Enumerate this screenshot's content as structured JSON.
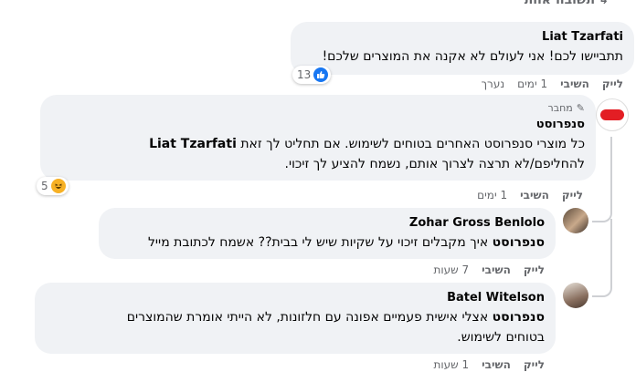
{
  "header": {
    "label": "תשובה אחת"
  },
  "comments": [
    {
      "author": "Liat Tzarfati",
      "text": "תתביישו לכם! אני לעולם לא אקנה את המוצרים שלכם!",
      "reaction": {
        "type": "like",
        "count": "13"
      },
      "actions": {
        "like": "לייק",
        "reply": "השיבי",
        "time": "1 ימים",
        "edited": "נערך"
      }
    },
    {
      "badge": "מחבר",
      "author": "סנפרוסט",
      "mention": "Liat Tzarfati",
      "text_line1_rest": "כל מוצרי סנפרוסט האחרים בטוחים לשימוש. אם תחליט לך זאת",
      "text_line2": "להחליפם/לא תרצה לצרוך אותם, נשמח להציע לך זיכוי.",
      "reaction": {
        "type": "haha",
        "count": "5"
      },
      "actions": {
        "like": "לייק",
        "reply": "השיבי",
        "time": "1 ימים"
      }
    },
    {
      "author": "Zohar Gross Benlolo",
      "mention": "סנפרוסט",
      "text_rest": "איך מקבלים זיכוי על שקיות שיש לי בבית?? אשמח לכתובת מייל",
      "actions": {
        "like": "לייק",
        "reply": "השיבי",
        "time": "7 שעות"
      }
    },
    {
      "author": "Batel Witelson",
      "mention": "סנפרוסט",
      "text_line1_rest": "אצלי אישית פעמיים אפונה עם חלזונות, לא הייתי אומרת שהמוצרים",
      "text_line2": "בטוחים לשימוש.",
      "actions": {
        "like": "לייק",
        "reply": "השיבי",
        "time": "1 שעות"
      }
    }
  ],
  "colors": {
    "bubble": "#f0f2f5",
    "meta": "#65676b",
    "like": "#1877f2",
    "brand_red": "#e31e24"
  }
}
